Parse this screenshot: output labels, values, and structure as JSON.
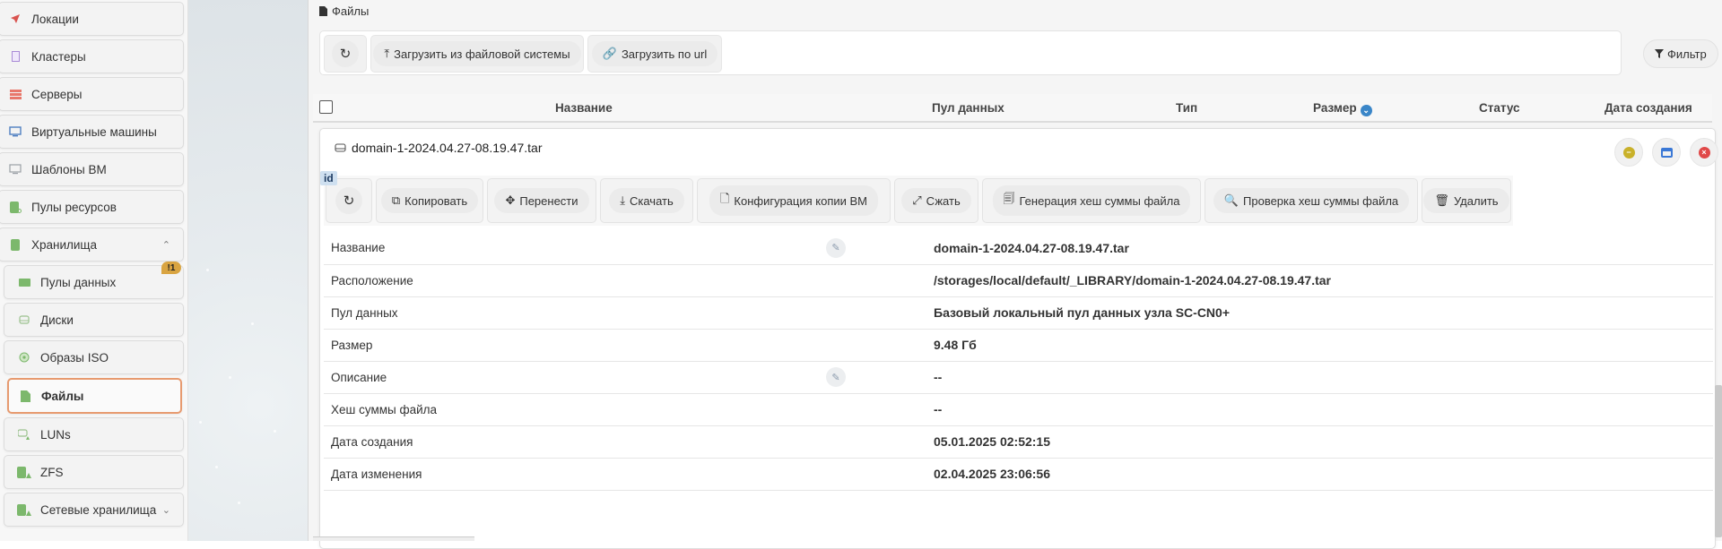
{
  "sidebar": {
    "items": [
      {
        "label": "Локации",
        "icon": "location-arrow-icon"
      },
      {
        "label": "Кластеры",
        "icon": "cluster-icon"
      },
      {
        "label": "Серверы",
        "icon": "server-icon"
      },
      {
        "label": "Виртуальные машины",
        "icon": "monitor-icon"
      },
      {
        "label": "Шаблоны ВМ",
        "icon": "template-icon"
      },
      {
        "label": "Пулы ресурсов",
        "icon": "resource-pool-icon"
      },
      {
        "label": "Хранилища",
        "icon": "storage-icon",
        "expanded": true
      },
      {
        "label": "Пулы данных",
        "icon": "folder-icon",
        "badge": "!1"
      },
      {
        "label": "Диски",
        "icon": "disk-icon"
      },
      {
        "label": "Образы ISO",
        "icon": "iso-icon"
      },
      {
        "label": "Файлы",
        "icon": "file-icon",
        "active": true
      },
      {
        "label": "LUNs",
        "icon": "lun-icon"
      },
      {
        "label": "ZFS",
        "icon": "zfs-icon"
      },
      {
        "label": "Сетевые хранилища",
        "icon": "network-storage-icon"
      }
    ]
  },
  "breadcrumb": "Файлы",
  "toolbar": {
    "upload_fs": "Загрузить из файловой системы",
    "upload_url": "Загрузить по url",
    "filter": "Фильтр"
  },
  "table": {
    "columns": [
      "Название",
      "Пул данных",
      "Тип",
      "Размер",
      "Статус",
      "Дата создания"
    ]
  },
  "card": {
    "title": "domain-1-2024.04.27-08.19.47.tar",
    "id_tag": "id",
    "actions": {
      "copy": "Копировать",
      "move": "Перенести",
      "download": "Скачать",
      "vm_config": "Конфигурация копии ВМ",
      "compress": "Сжать",
      "hash_gen": "Генерация хеш суммы файла",
      "hash_check": "Проверка хеш суммы файла",
      "delete": "Удалить"
    },
    "details": [
      {
        "label": "Название",
        "value": "domain-1-2024.04.27-08.19.47.tar",
        "editable": true
      },
      {
        "label": "Расположение",
        "value": "/storages/local/default/_LIBRARY/domain-1-2024.04.27-08.19.47.tar"
      },
      {
        "label": "Пул данных",
        "value": "Базовый локальный пул данных узла SC-CN0+"
      },
      {
        "label": "Размер",
        "value": "9.48 Гб"
      },
      {
        "label": "Описание",
        "value": "--",
        "editable": true
      },
      {
        "label": "Хеш суммы файла",
        "value": "--"
      },
      {
        "label": "Дата создания",
        "value": "05.01.2025 02:52:15"
      },
      {
        "label": "Дата изменения",
        "value": "02.04.2025 23:06:56"
      }
    ]
  },
  "colors": {
    "active_border": "#e79a6f",
    "badge": "#d9a441",
    "minimize": "#c9b12a",
    "maximize": "#3a78d6",
    "close": "#e04848",
    "id_tag": "#cfe0f0"
  }
}
